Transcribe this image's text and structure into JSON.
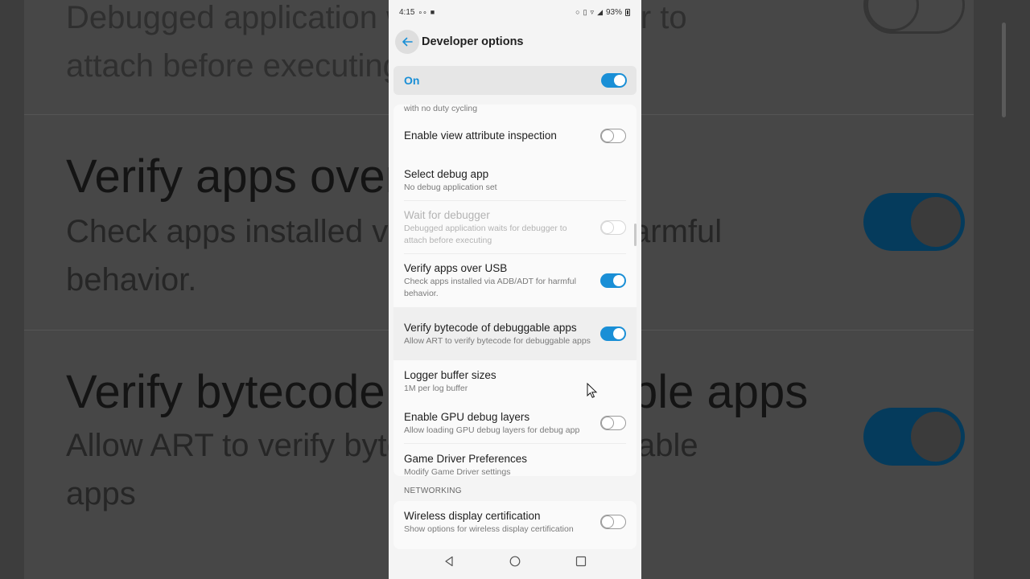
{
  "background": {
    "line1": "Debugged application waits for debugger to",
    "line2": "attach before executing",
    "title_verify_usb": "Verify apps over USB",
    "sub_verify_usb_1": "Check apps installed via ADB/ADT for harmful",
    "sub_verify_usb_2": "behavior.",
    "title_verify_bytecode": "Verify bytecode of debuggable apps",
    "sub_verify_bytecode_1": "Allow ART to verify bytecode for debuggable",
    "sub_verify_bytecode_2": "apps"
  },
  "status_bar": {
    "time": "4:15",
    "battery": "93%"
  },
  "app_bar": {
    "title": "Developer options"
  },
  "master_switch": {
    "label": "On",
    "state": "on"
  },
  "list": {
    "cut_off_text": "with no duty cycling",
    "items": [
      {
        "title": "Enable view attribute inspection",
        "toggle": "off"
      },
      {
        "title": "Select debug app",
        "subtitle": "No debug application set"
      },
      {
        "title": "Wait for debugger",
        "subtitle": "Debugged application waits for debugger to attach before executing",
        "toggle": "off",
        "disabled": true
      },
      {
        "title": "Verify apps over USB",
        "subtitle": "Check apps installed via ADB/ADT for harmful behavior.",
        "toggle": "on"
      },
      {
        "title": "Verify bytecode of debuggable apps",
        "subtitle": "Allow ART to verify bytecode for debuggable apps",
        "toggle": "on"
      },
      {
        "title": "Logger buffer sizes",
        "subtitle": "1M per log buffer"
      },
      {
        "title": "Enable GPU debug layers",
        "subtitle": "Allow loading GPU debug layers for debug app",
        "toggle": "off"
      },
      {
        "title": "Game Driver Preferences",
        "subtitle": "Modify Game Driver settings"
      }
    ]
  },
  "networking": {
    "section_label": "NETWORKING",
    "items": [
      {
        "title": "Wireless display certification",
        "subtitle": "Show options for wireless display certification",
        "toggle": "off"
      }
    ]
  },
  "colors": {
    "accent": "#1a8fd6"
  },
  "icons": {
    "back": "arrow-left-icon",
    "nav_back": "triangle-back-icon",
    "nav_home": "circle-home-icon",
    "nav_recents": "square-recents-icon"
  }
}
